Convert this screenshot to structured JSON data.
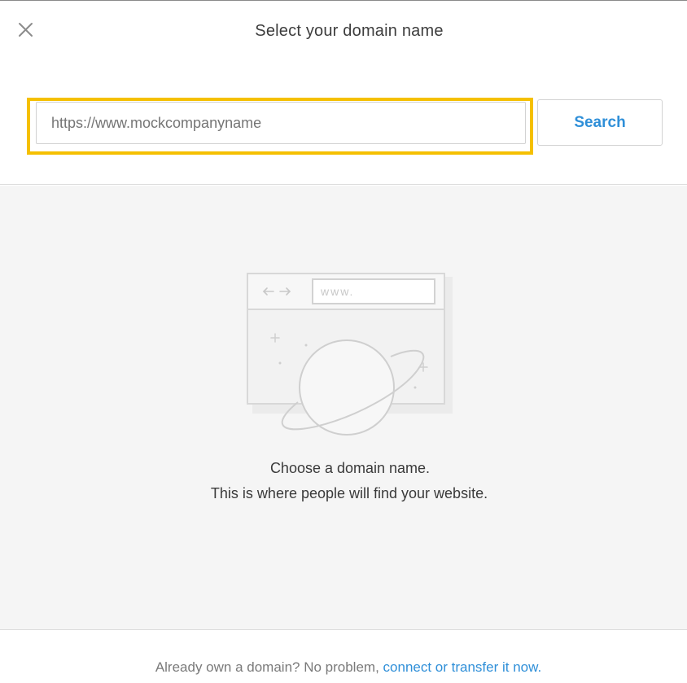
{
  "dialog": {
    "title": "Select your domain name",
    "close_icon": "close-icon"
  },
  "search": {
    "value": "",
    "placeholder": "https://www.mockcompanyname",
    "button_label": "Search",
    "highlight_color": "#f5c000"
  },
  "empty_state": {
    "illustration": "browser-planet-illustration",
    "illustration_url_text": "www.",
    "line1": "Choose a domain name.",
    "line2": "This is where people will find your website."
  },
  "footer": {
    "text": "Already own a domain? No problem,",
    "link_text": "connect or transfer it now.",
    "link_color": "#2f8fd8"
  }
}
